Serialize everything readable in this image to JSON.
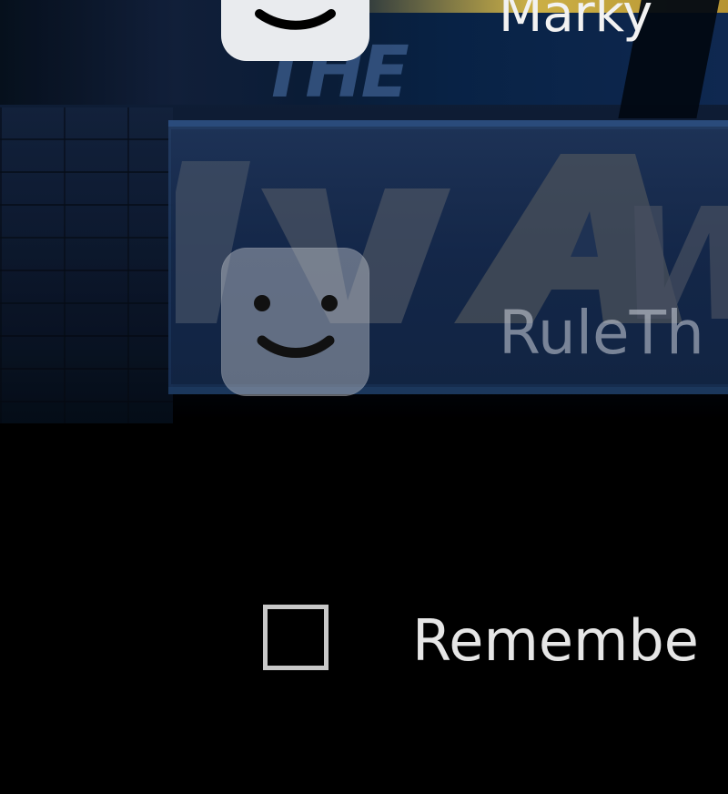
{
  "background": {
    "sign_text_small": "THE",
    "sign_text_large": "WA",
    "colors": {
      "navy": "#13284a",
      "gold": "#d7ba4a",
      "screen": "#000000"
    }
  },
  "accounts": [
    {
      "name": "Marky",
      "avatar_icon": "smiley-face-icon",
      "state": "selected"
    },
    {
      "name": "RuleTh",
      "avatar_icon": "smiley-face-icon",
      "state": "dimmed"
    }
  ],
  "remember": {
    "label": "Remembe",
    "checked": false
  }
}
